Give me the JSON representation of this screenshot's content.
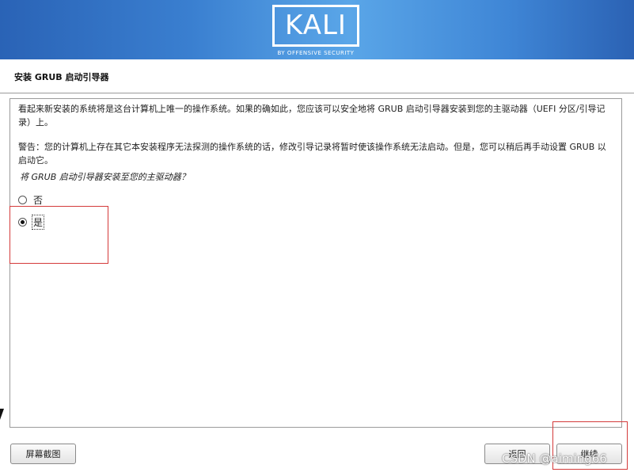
{
  "banner": {
    "logo": "KALI",
    "tagline": "BY OFFENSIVE SECURITY"
  },
  "page": {
    "title": "安装 GRUB 启动引导器"
  },
  "content": {
    "paragraph1": "看起来新安装的系统将是这台计算机上唯一的操作系统。如果的确如此，您应该可以安全地将 GRUB 启动引导器安装到您的主驱动器（UEFI 分区/引导记录）上。",
    "paragraph2": "警告：您的计算机上存在其它本安装程序无法探测的操作系统的话，修改引导记录将暂时使该操作系统无法启动。但是，您可以稍后再手动设置 GRUB 以启动它。",
    "question": "将 GRUB 启动引导器安装至您的主驱动器？",
    "options": [
      {
        "label": "否",
        "selected": false
      },
      {
        "label": "是",
        "selected": true
      }
    ]
  },
  "buttons": {
    "screenshot": "屏幕截图",
    "back": "返回",
    "continue": "继续"
  },
  "watermark": "CSDN @aiming66",
  "colors": {
    "annotation_box": "#d43a3a",
    "banner_blue": "#3a7fd0"
  }
}
